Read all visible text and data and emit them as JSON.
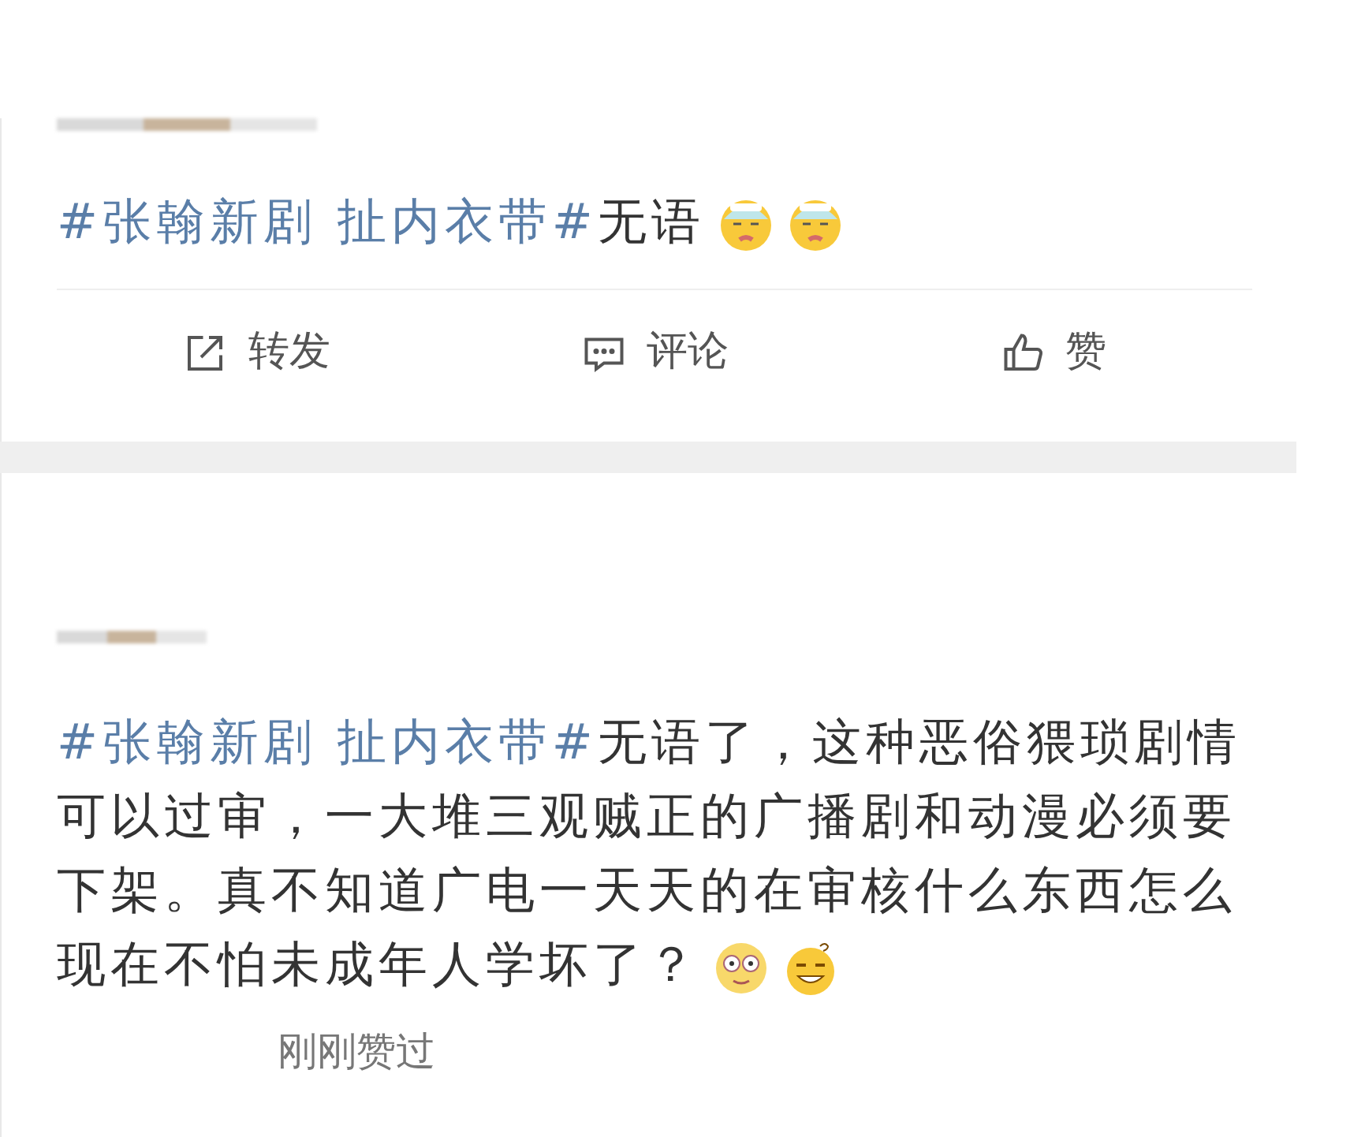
{
  "posts": [
    {
      "hashtag": "#张翰新剧 扯内衣带#",
      "text": "无语",
      "emojis": [
        {
          "kind": "sick"
        },
        {
          "kind": "sick"
        }
      ],
      "actions": [
        {
          "kind": "repost",
          "label": "转发"
        },
        {
          "kind": "comment",
          "label": "评论"
        },
        {
          "kind": "like",
          "label": "赞"
        }
      ]
    },
    {
      "hashtag": "#张翰新剧 扯内衣带#",
      "text": "无语了，这种恶俗猥琐剧情可以过审，一大堆三观贼正的广播剧和动漫必须要下架。真不知道广电一天天的在审核什么东西怎么现在不怕未成年人学坏了？",
      "emojis": [
        {
          "kind": "dizzy"
        },
        {
          "kind": "confused"
        }
      ],
      "footer": "刚刚赞过"
    }
  ]
}
